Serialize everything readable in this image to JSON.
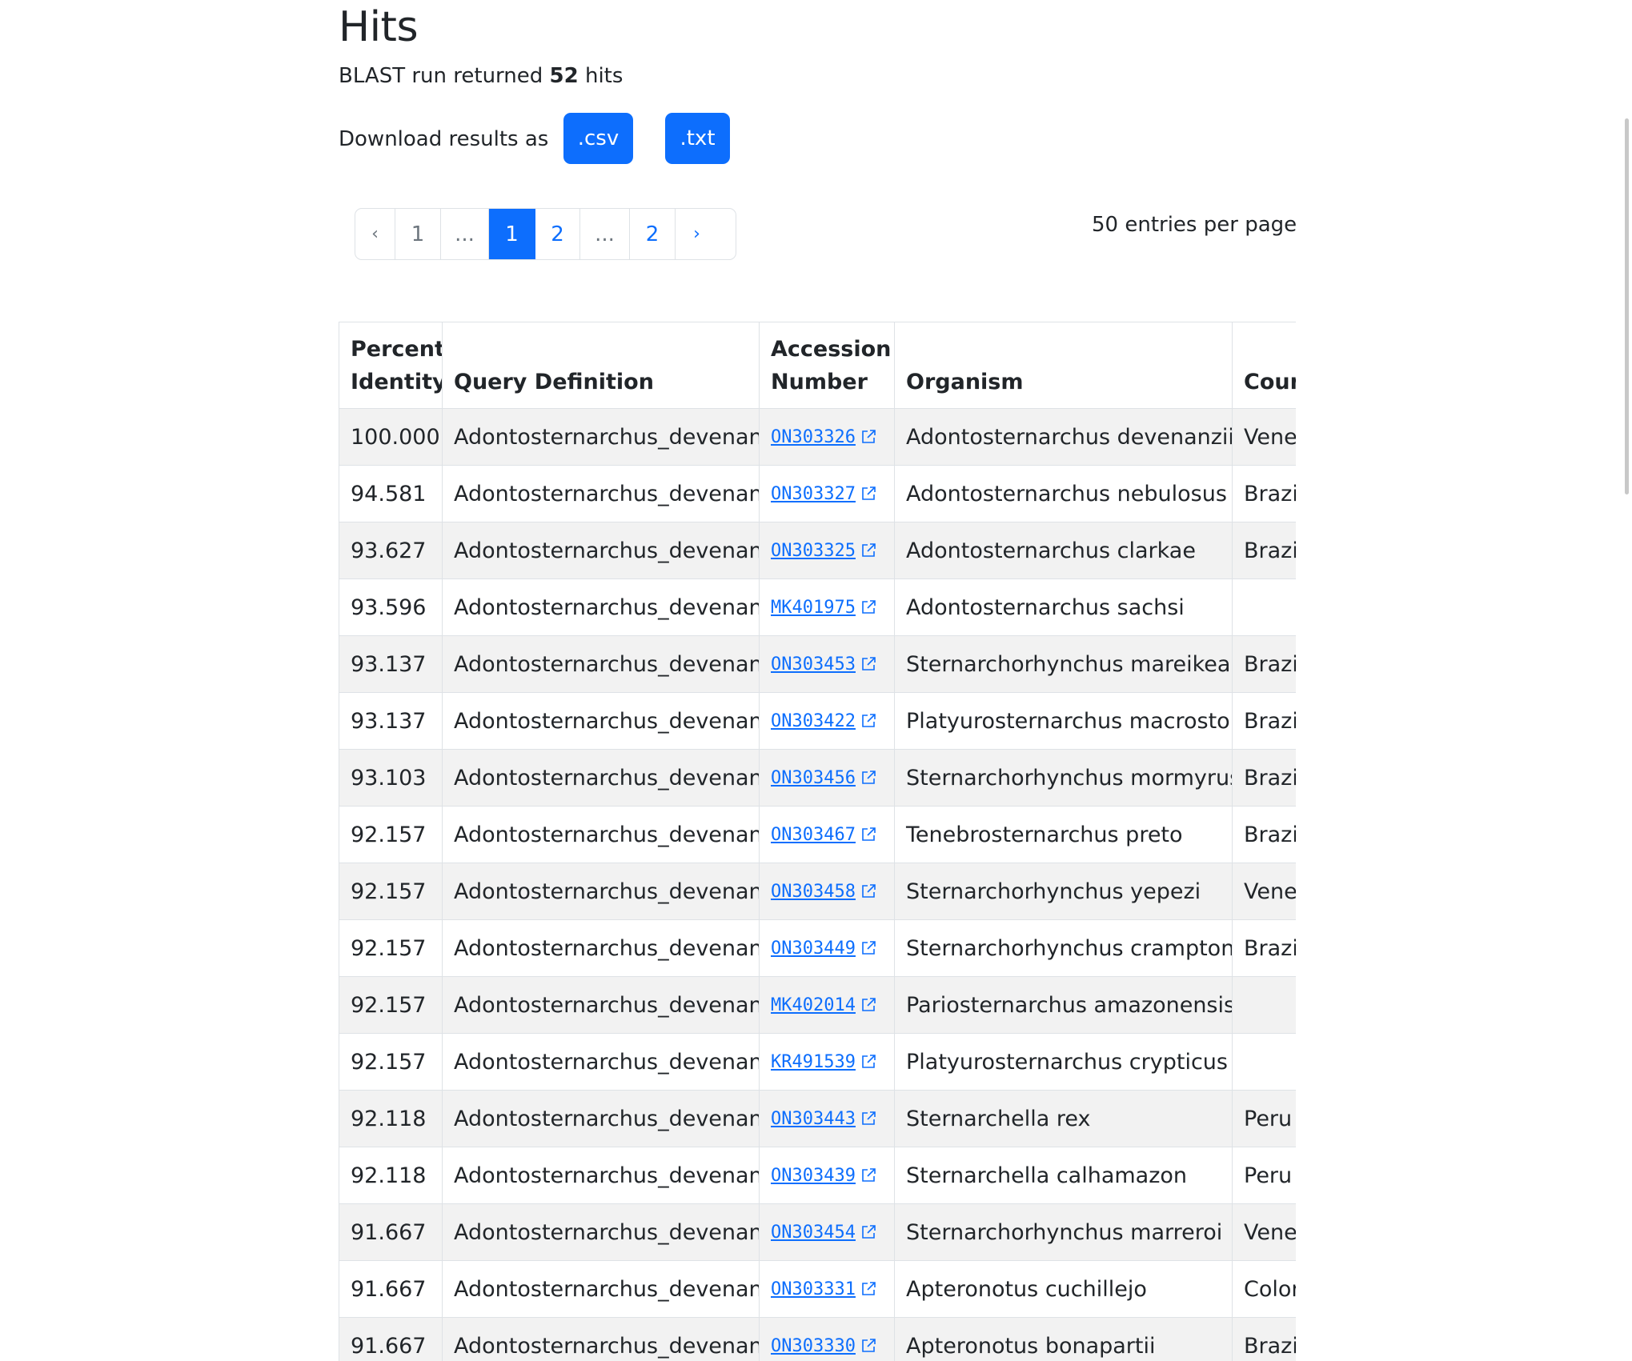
{
  "title": "Hits",
  "summary": {
    "prefix": "BLAST run returned",
    "count": "52",
    "suffix": "hits"
  },
  "download": {
    "label": "Download results as",
    "csv": ".csv",
    "txt": ".txt"
  },
  "pagination": {
    "prev": "‹",
    "first": "1",
    "ellipsis1": "...",
    "current": "1",
    "next_page": "2",
    "ellipsis2": "...",
    "last": "2",
    "next": "›"
  },
  "per_page": "50 entries per page",
  "table": {
    "headers": {
      "pid_line1": "Percent",
      "pid_line2": "Identity",
      "query": "Query Definition",
      "acc_line1": "Accession",
      "acc_line2": "Number",
      "organism": "Organism",
      "country": "Coun"
    },
    "rows": [
      {
        "pid": "100.000",
        "query": "Adontosternarchus_devenanzii",
        "acc": "ON303326",
        "org": "Adontosternarchus devenanzii",
        "country": "Venez"
      },
      {
        "pid": "94.581",
        "query": "Adontosternarchus_devenanzii",
        "acc": "ON303327",
        "org": "Adontosternarchus nebulosus",
        "country": "Brazil"
      },
      {
        "pid": "93.627",
        "query": "Adontosternarchus_devenanzii",
        "acc": "ON303325",
        "org": "Adontosternarchus clarkae",
        "country": "Brazil"
      },
      {
        "pid": "93.596",
        "query": "Adontosternarchus_devenanzii",
        "acc": "MK401975",
        "org": "Adontosternarchus sachsi",
        "country": ""
      },
      {
        "pid": "93.137",
        "query": "Adontosternarchus_devenanzii",
        "acc": "ON303453",
        "org": "Sternarchorhynchus mareikeae",
        "country": "Brazil"
      },
      {
        "pid": "93.137",
        "query": "Adontosternarchus_devenanzii",
        "acc": "ON303422",
        "org": "Platyurosternarchus macrostoma",
        "country": "Brazil"
      },
      {
        "pid": "93.103",
        "query": "Adontosternarchus_devenanzii",
        "acc": "ON303456",
        "org": "Sternarchorhynchus mormyrus",
        "country": "Brazil"
      },
      {
        "pid": "92.157",
        "query": "Adontosternarchus_devenanzii",
        "acc": "ON303467",
        "org": "Tenebrosternarchus preto",
        "country": "Brazil"
      },
      {
        "pid": "92.157",
        "query": "Adontosternarchus_devenanzii",
        "acc": "ON303458",
        "org": "Sternarchorhynchus yepezi",
        "country": "Venez"
      },
      {
        "pid": "92.157",
        "query": "Adontosternarchus_devenanzii",
        "acc": "ON303449",
        "org": "Sternarchorhynchus cramptoni",
        "country": "Brazil"
      },
      {
        "pid": "92.157",
        "query": "Adontosternarchus_devenanzii",
        "acc": "MK402014",
        "org": "Pariosternarchus amazonensis",
        "country": ""
      },
      {
        "pid": "92.157",
        "query": "Adontosternarchus_devenanzii",
        "acc": "KR491539",
        "org": "Platyurosternarchus crypticus",
        "country": ""
      },
      {
        "pid": "92.118",
        "query": "Adontosternarchus_devenanzii",
        "acc": "ON303443",
        "org": "Sternarchella rex",
        "country": "Peru"
      },
      {
        "pid": "92.118",
        "query": "Adontosternarchus_devenanzii",
        "acc": "ON303439",
        "org": "Sternarchella calhamazon",
        "country": "Peru"
      },
      {
        "pid": "91.667",
        "query": "Adontosternarchus_devenanzii",
        "acc": "ON303454",
        "org": "Sternarchorhynchus marreroi",
        "country": "Venez"
      },
      {
        "pid": "91.667",
        "query": "Adontosternarchus_devenanzii",
        "acc": "ON303331",
        "org": "Apteronotus cuchillejo",
        "country": "Color"
      },
      {
        "pid": "91.667",
        "query": "Adontosternarchus_devenanzii",
        "acc": "ON303330",
        "org": "Apteronotus bonapartii",
        "country": "Brazil"
      }
    ]
  },
  "colors": {
    "primary": "#0d6efd",
    "stripe": "#f2f2f2",
    "border": "#dee2e6",
    "text": "#212529"
  },
  "icons": {
    "external_link": "external-link-icon"
  }
}
